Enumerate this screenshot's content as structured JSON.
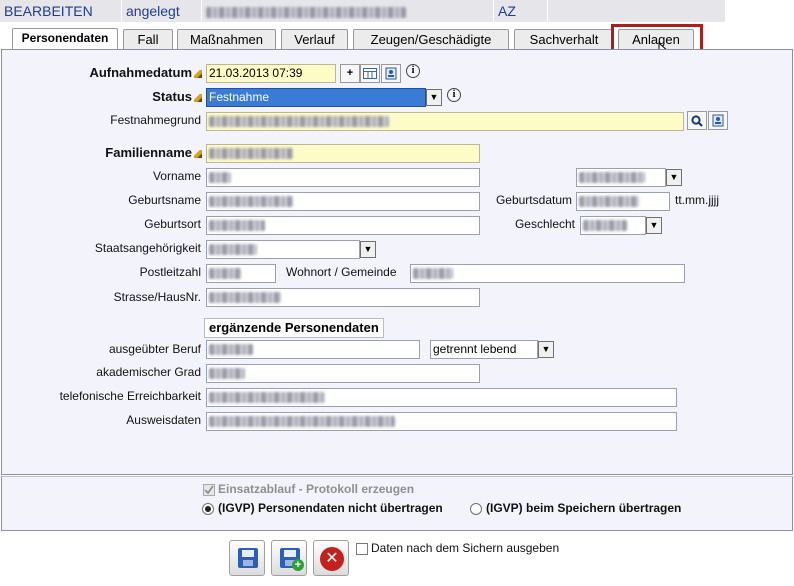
{
  "header": {
    "mode": "BEARBEITEN",
    "status": "angelegt",
    "az_label": "AZ"
  },
  "tabs": [
    {
      "label": "Personendaten",
      "active": true
    },
    {
      "label": "Fall"
    },
    {
      "label": "Maßnahmen"
    },
    {
      "label": "Verlauf"
    },
    {
      "label": "Zeugen/Geschädigte"
    },
    {
      "label": "Sachverhalt"
    },
    {
      "label": "Anlagen",
      "highlighted": true
    }
  ],
  "form": {
    "aufnahmedatum": {
      "label": "Aufnahmedatum",
      "value": "21.03.2013 07:39"
    },
    "status": {
      "label": "Status",
      "value": "Festnahme"
    },
    "festnahmegrund": {
      "label": "Festnahmegrund"
    },
    "familienname": {
      "label": "Familienname"
    },
    "vorname": {
      "label": "Vorname"
    },
    "geburtsname": {
      "label": "Geburtsname"
    },
    "geburtsdatum": {
      "label": "Geburtsdatum",
      "hint": "tt.mm.jjjj"
    },
    "geburtsort": {
      "label": "Geburtsort"
    },
    "geschlecht": {
      "label": "Geschlecht"
    },
    "staatsangehoerigkeit": {
      "label": "Staatsangehörigkeit"
    },
    "postleitzahl": {
      "label": "Postleitzahl"
    },
    "wohnort": {
      "label": "Wohnort / Gemeinde"
    },
    "strasse": {
      "label": "Strasse/HausNr."
    },
    "section_title": "ergänzende Personendaten",
    "beruf": {
      "label": "ausgeübter Beruf"
    },
    "familienstand": {
      "value": "getrennt lebend"
    },
    "grad": {
      "label": "akademischer Grad"
    },
    "telefon": {
      "label": "telefonische Erreichbarkeit"
    },
    "ausweis": {
      "label": "Ausweisdaten"
    }
  },
  "options": {
    "protokoll": {
      "label": "Einsatzablauf - Protokoll erzeugen",
      "checked": true,
      "disabled": true
    },
    "radio_nicht": {
      "label": "(IGVP) Personendaten nicht übertragen",
      "selected": true
    },
    "radio_beim": {
      "label": "(IGVP) beim Speichern übertragen",
      "selected": false
    }
  },
  "footer": {
    "ausgeben_label": "Daten nach dem Sichern ausgeben"
  },
  "icons": [
    "calendar-plus-icon",
    "calendar-icon",
    "phonebook-icon",
    "info-icon",
    "search-icon",
    "dropdown-arrow-icon",
    "save-icon",
    "save-new-icon",
    "cancel-icon",
    "cursor-icon"
  ],
  "colors": {
    "header_text": "#1f3b95",
    "panel_bg": "#f3f4fb",
    "required_bg": "#fdfcc6",
    "status_select_bg": "#3a7bd5",
    "highlight_border": "#b01c1c",
    "cancel_red": "#c4201e"
  }
}
